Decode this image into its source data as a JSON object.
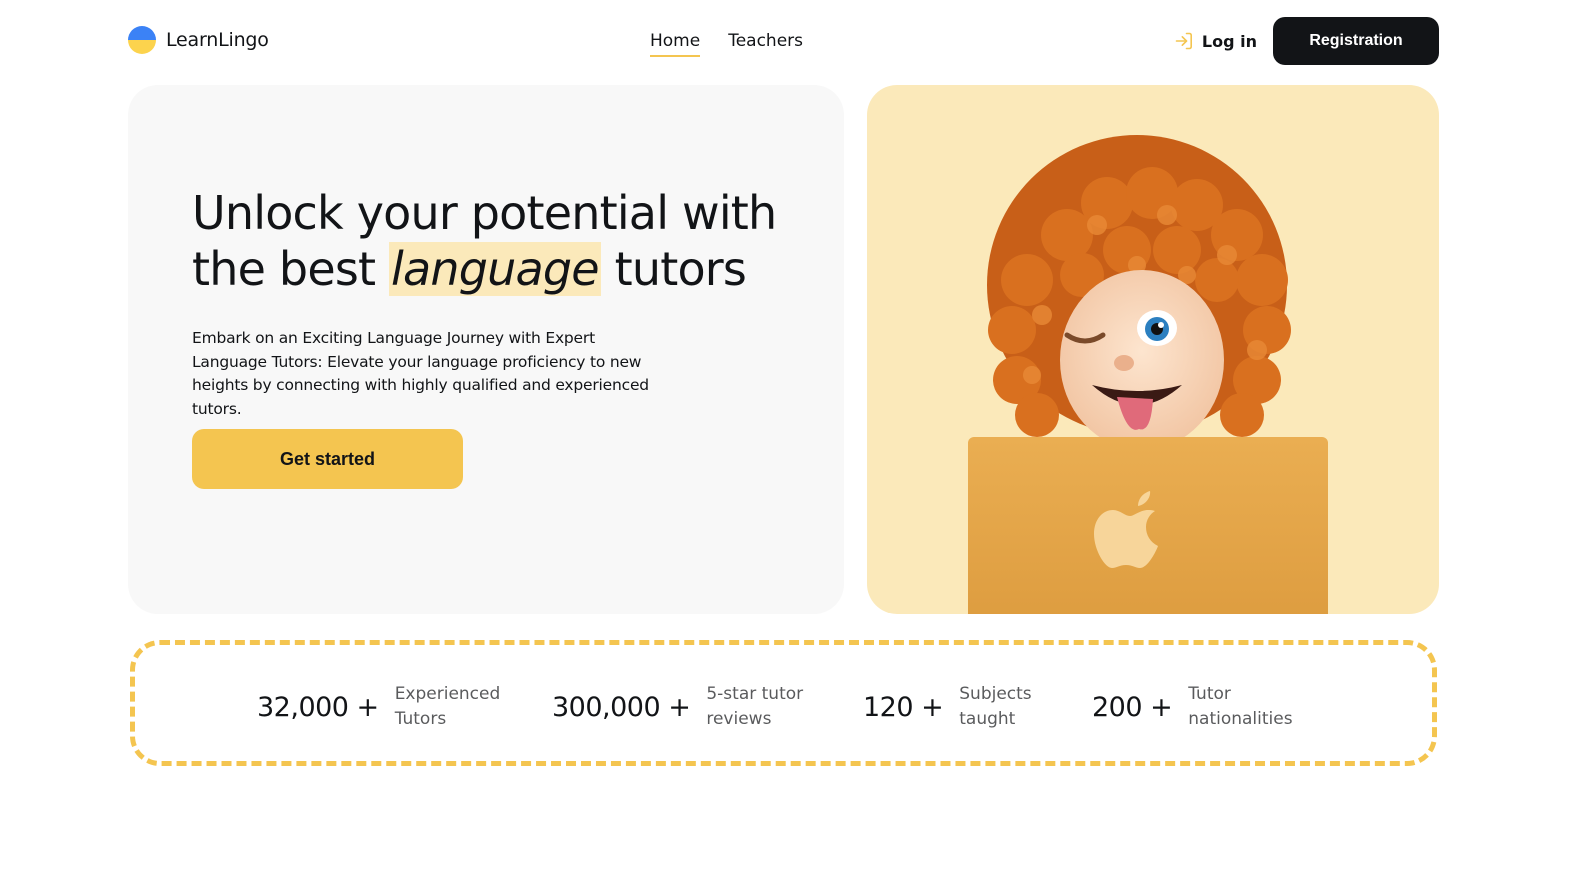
{
  "header": {
    "logo_text": "LearnLingo",
    "nav": [
      {
        "label": "Home",
        "active": true
      },
      {
        "label": "Teachers",
        "active": false
      }
    ],
    "login_label": "Log in",
    "register_label": "Registration"
  },
  "hero": {
    "title_before": "Unlock your potential with the best ",
    "title_highlight": "language",
    "title_after": " tutors",
    "description": "Embark on an Exciting Language Journey with Expert Language Tutors: Elevate your language proficiency to new heights by connecting with highly qualified and experienced tutors.",
    "cta_label": "Get started"
  },
  "stats": [
    {
      "value": "32,000 +",
      "label": "Experienced Tutors"
    },
    {
      "value": "300,000 +",
      "label": "5-star tutor reviews"
    },
    {
      "value": "120 +",
      "label": "Subjects taught"
    },
    {
      "value": "200 +",
      "label": "Tutor nationalities"
    }
  ],
  "colors": {
    "accent": "#f4c550",
    "accent_light": "#fbe9ba",
    "dark": "#121417",
    "panel": "#f8f8f8"
  },
  "icons": {
    "login": "login-arrow-icon",
    "logo": "ukraine-flag-icon",
    "laptop_logo": "apple-logo-icon"
  }
}
